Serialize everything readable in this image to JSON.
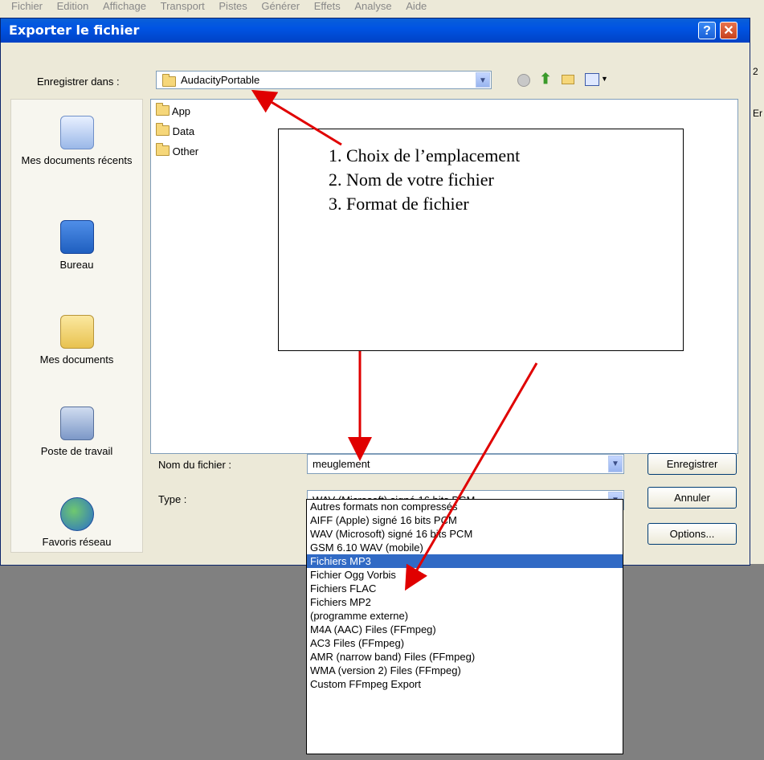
{
  "app_menu": [
    "Fichier",
    "Edition",
    "Affichage",
    "Transport",
    "Pistes",
    "Générer",
    "Effets",
    "Analyse",
    "Aide"
  ],
  "app_strip": {
    "t1": "2",
    "t2": "Er"
  },
  "dialog": {
    "title": "Exporter le fichier",
    "help_glyph": "?",
    "close_glyph": "✕"
  },
  "save_in": {
    "label": "Enregistrer dans :",
    "value": "AudacityPortable"
  },
  "places": [
    {
      "label": "Mes documents récents",
      "icon": "recent-documents-icon"
    },
    {
      "label": "Bureau",
      "icon": "desktop-icon"
    },
    {
      "label": "Mes documents",
      "icon": "my-documents-icon"
    },
    {
      "label": "Poste de travail",
      "icon": "my-computer-icon"
    },
    {
      "label": "Favoris réseau",
      "icon": "network-places-icon"
    }
  ],
  "files": [
    "App",
    "Data",
    "Other"
  ],
  "filename": {
    "label": "Nom du fichier :",
    "value": "meuglement"
  },
  "type": {
    "label": "Type :",
    "value": "WAV (Microsoft) signé 16 bits PCM"
  },
  "buttons": {
    "save": "Enregistrer",
    "cancel": "Annuler",
    "options": "Options..."
  },
  "type_options": [
    "Autres formats non compressés",
    "AIFF (Apple) signé 16 bits PCM",
    "WAV (Microsoft) signé 16 bits PCM",
    "GSM 6.10 WAV (mobile)",
    "Fichiers MP3",
    "Fichier Ogg Vorbis",
    "Fichiers FLAC",
    "Fichiers MP2",
    "(programme externe)",
    "M4A (AAC) Files (FFmpeg)",
    "AC3 Files (FFmpeg)",
    "AMR (narrow band) Files (FFmpeg)",
    "WMA (version 2) Files (FFmpeg)",
    "Custom FFmpeg Export"
  ],
  "selected_type_index": 4,
  "annotation": {
    "items": [
      "1.  Choix de l’emplacement",
      "2.  Nom de votre fichier",
      "3.  Format de fichier"
    ]
  },
  "colors": {
    "arrow": "#e00000",
    "selection": "#316ac5",
    "titlebar": "#0054e3"
  }
}
